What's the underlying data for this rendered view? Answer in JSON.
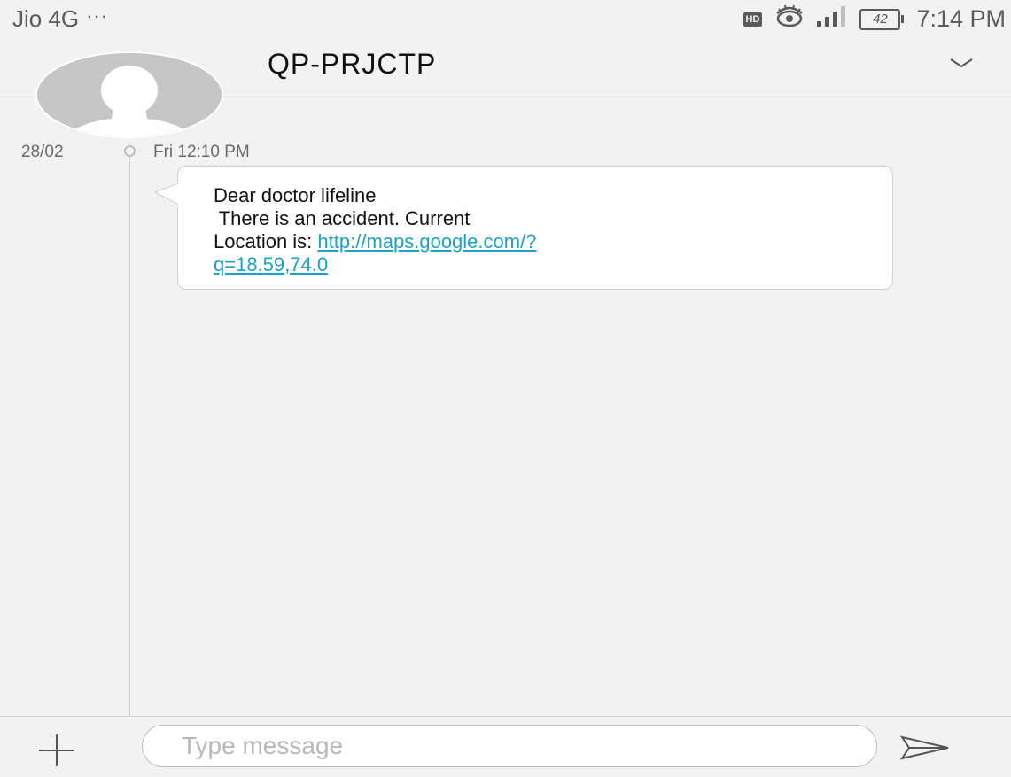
{
  "status_bar": {
    "carrier": "Jio 4G",
    "more": "···",
    "hd_badge": "HD",
    "battery_level": "42",
    "time": "7:14 PM"
  },
  "header": {
    "contact_name": "QP-PRJCTP"
  },
  "conversation": {
    "date": "28/02",
    "time": "Fri 12:10 PM",
    "message": {
      "line1": "Dear doctor lifeline",
      "line2": " There is an accident. Current",
      "line3_prefix": "Location is: ",
      "link_part1": "http://maps.google.com/?",
      "link_part2": "q=18.59,74.0"
    }
  },
  "compose": {
    "placeholder": "Type message"
  },
  "icons": {
    "eye": "eye-icon",
    "signal": "signal-icon",
    "battery": "battery-icon",
    "chevron": "chevron-down-icon",
    "avatar": "person-icon",
    "plus": "plus-icon",
    "send": "send-icon"
  }
}
